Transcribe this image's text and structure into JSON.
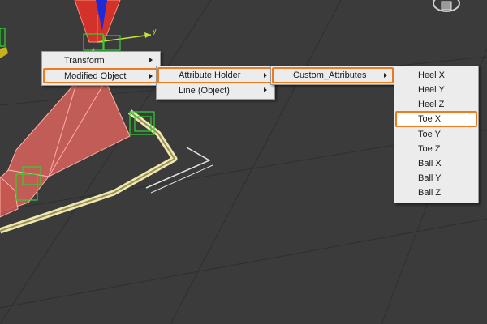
{
  "scene": {
    "axis_y_label": "y",
    "colors": {
      "background": "#3b3b3b",
      "grid": "#2e2e2e",
      "foot_mesh": "#d9645c",
      "spline": "#efe9b0",
      "control_boxes": "#2fd22f",
      "highlight": "#f07a1e",
      "menu_bg": "#ececec"
    }
  },
  "menus": {
    "level1": [
      {
        "label": "Transform",
        "submenu": true
      },
      {
        "label": "Modified Object",
        "submenu": true,
        "highlighted": true
      }
    ],
    "level2": [
      {
        "label": "Attribute Holder",
        "submenu": true,
        "highlighted": true
      },
      {
        "label": "Line (Object)",
        "submenu": true
      }
    ],
    "level3": [
      {
        "label": "Custom_Attributes",
        "submenu": true,
        "highlighted": true
      }
    ],
    "level4": [
      {
        "label": "Heel X"
      },
      {
        "label": "Heel Y"
      },
      {
        "label": "Heel Z"
      },
      {
        "label": "Toe X",
        "highlighted": true
      },
      {
        "label": "Toe Y"
      },
      {
        "label": "Toe Z"
      },
      {
        "label": "Ball X"
      },
      {
        "label": "Ball Y"
      },
      {
        "label": "Ball Z"
      }
    ]
  }
}
